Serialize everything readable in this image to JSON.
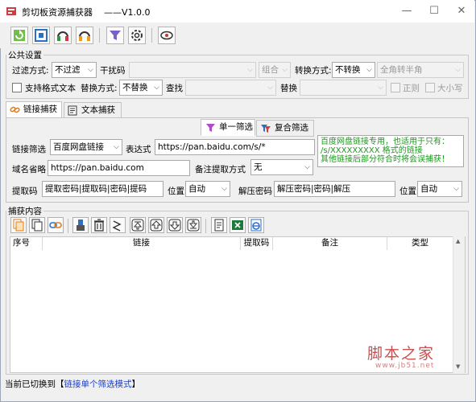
{
  "window": {
    "title": "剪切板资源捕获器    ——V1.0.0",
    "min_glyph": "—",
    "max_glyph": "☐",
    "close_glyph": "✕"
  },
  "toolbar": {
    "buttons": [
      "refresh-icon",
      "capture-icon",
      "headset-green-icon",
      "headset-orange-icon",
      "filter-icon",
      "gear-icon",
      "eye-icon"
    ]
  },
  "public_settings": {
    "group_label": "公共设置",
    "filter_mode_label": "过滤方式:",
    "filter_mode_value": "不过滤",
    "interference_label": "干扰码",
    "interference_value": "",
    "combine_value": "组合",
    "convert_mode_label": "转换方式:",
    "convert_mode_value": "不转换",
    "width_value": "全角转半角",
    "support_format_label": "支持格式文本",
    "replace_mode_label": "替换方式:",
    "replace_mode_value": "不替换",
    "find_label": "查找",
    "find_value": "",
    "replace_label": "替换",
    "replace_value": "",
    "regex_label": "正则",
    "case_label": "大小写"
  },
  "tabs": {
    "link_capture": "链接捕获",
    "text_capture": "文本捕获"
  },
  "subtabs": {
    "single_filter": "单一筛选",
    "multi_filter": "复合筛选"
  },
  "link_form": {
    "link_filter_label": "链接筛选",
    "link_filter_value": "百度网盘链接",
    "expression_label": "表达式",
    "expression_value": "https://pan.baidu.com/s/*",
    "domain_label": "域名省略",
    "domain_value": "https://pan.baidu.com",
    "note_extract_label": "备注提取方式",
    "note_extract_value": "无",
    "note_text": "百度网盘链接专用，也适用于只有：\n/s/XXXXXXXXX 格式的链接\n其他链接后部分符合时将会误捕获！",
    "extract_code_label": "提取码",
    "extract_code_value": "提取密码|提取码|密码|提码",
    "position_label": "位置",
    "position_value": "自动",
    "unzip_label": "解压密码",
    "unzip_value": "解压密码|密码|解压",
    "position2_label": "位置",
    "position2_value": "自动"
  },
  "capture": {
    "group_label": "捕获内容",
    "columns": [
      "序号",
      "链接",
      "提取码",
      "备注",
      "类型"
    ],
    "rows": []
  },
  "status": {
    "prefix": "当前已切换到【",
    "mode": "链接单个筛选模式",
    "suffix": "】"
  },
  "watermark": {
    "line1": "脚本之家",
    "line2": "www.jb51.net"
  }
}
